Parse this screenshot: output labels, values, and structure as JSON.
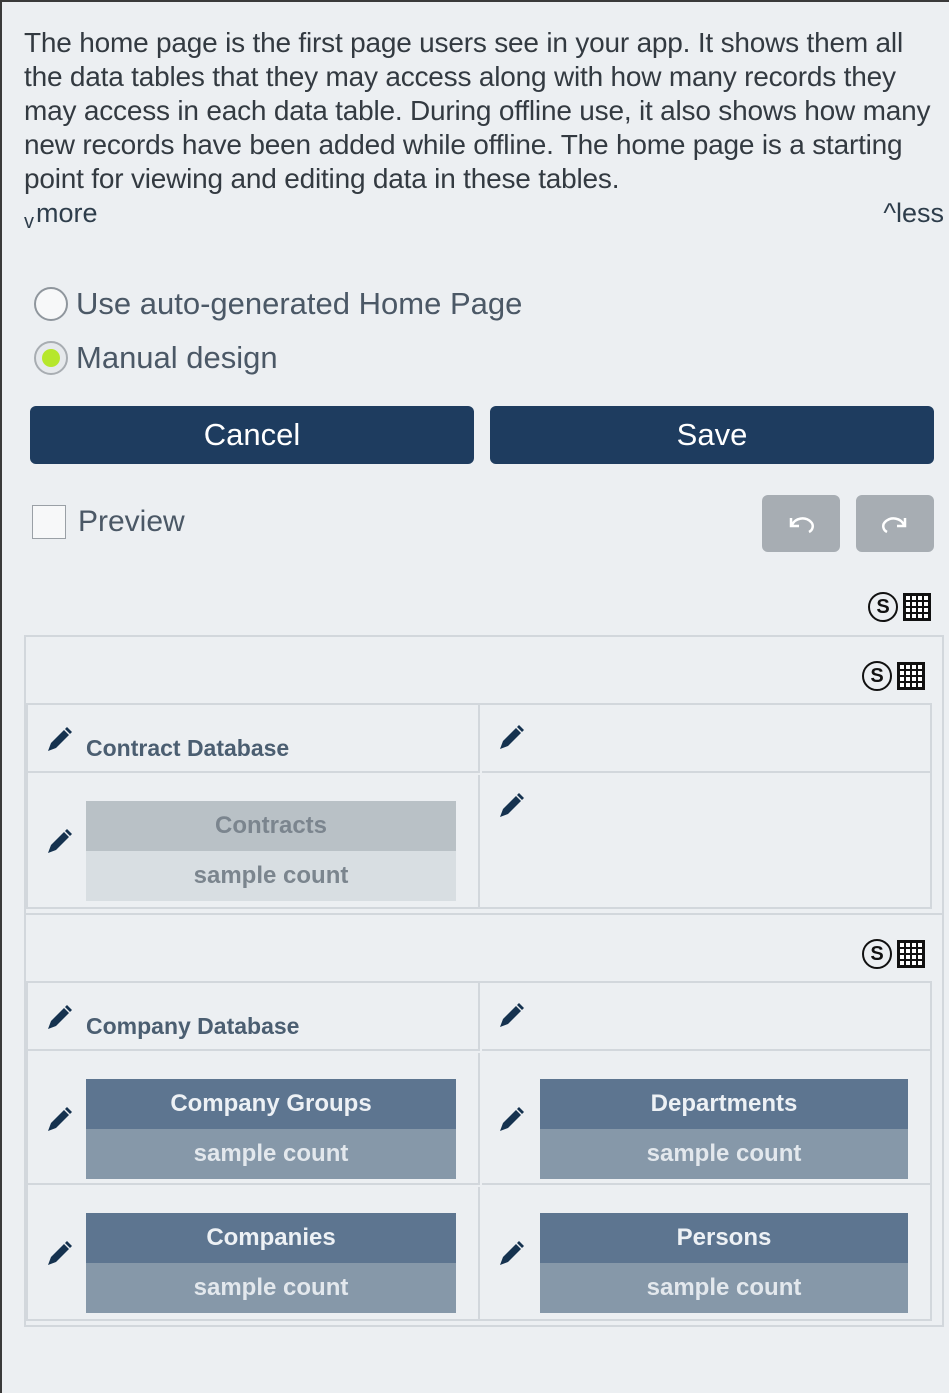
{
  "intro": {
    "text": "The home page is the first page users see in your app. It shows them all the data tables that they may access along with how many records they may access in each data table. During offline use, it also shows how many new records have been added while offline. The home page is a starting point for viewing and editing data in these tables.",
    "more_label": "more",
    "more_prefix": "v",
    "less_label": "^less"
  },
  "options": {
    "auto_label": "Use auto-generated Home Page",
    "manual_label": "Manual design",
    "selected": "manual"
  },
  "buttons": {
    "cancel": "Cancel",
    "save": "Save"
  },
  "preview": {
    "label": "Preview",
    "checked": false
  },
  "controls": {
    "style_glyph": "S"
  },
  "sections": [
    {
      "db_label": "Contract Database",
      "tiles": [
        {
          "title": "Contracts",
          "count": "sample count"
        }
      ]
    },
    {
      "db_label": "Company Database",
      "tiles": [
        {
          "title": "Company Groups",
          "count": "sample count"
        },
        {
          "title": "Departments",
          "count": "sample count"
        },
        {
          "title": "Companies",
          "count": "sample count"
        },
        {
          "title": "Persons",
          "count": "sample count"
        }
      ]
    }
  ],
  "icons": {
    "pencil": "pencil-icon",
    "style": "style-icon",
    "grid": "table-grid-icon",
    "undo": "undo-icon",
    "redo": "redo-icon"
  },
  "colors": {
    "primary_button": "#1e3c5f",
    "radio_selected": "#b6e72b",
    "tile_dark": "#5d7590",
    "tile_light": "#b9c1c6"
  }
}
